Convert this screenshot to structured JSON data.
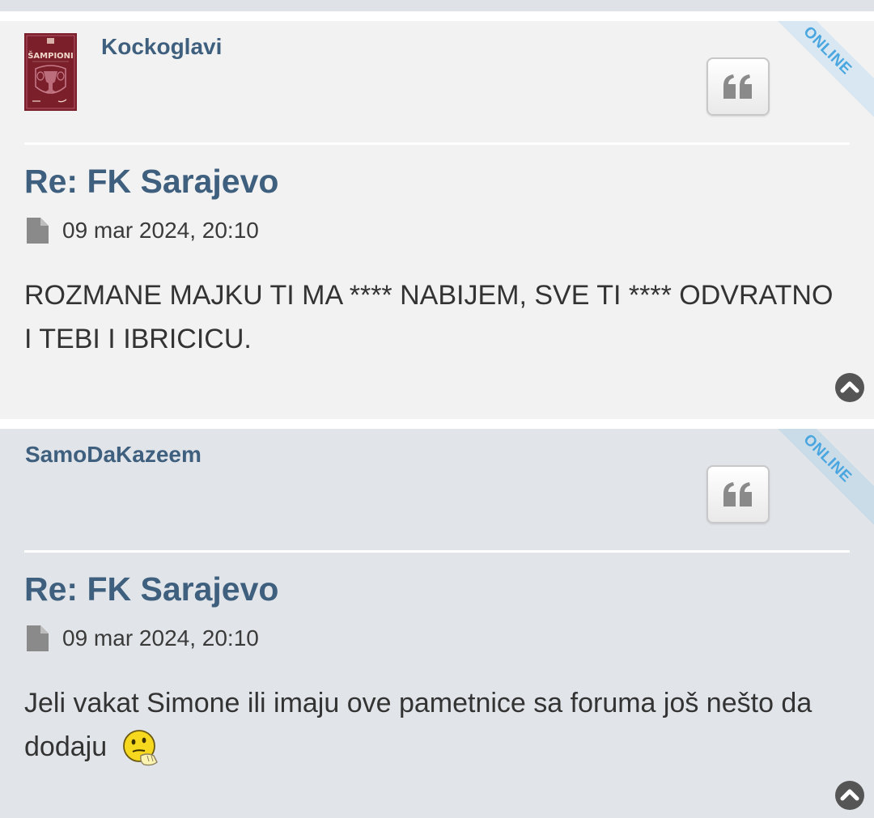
{
  "posts": [
    {
      "author": "Kockoglavi",
      "status": "ONLINE",
      "avatar": {
        "top_text": "ŠAMPIONI",
        "colors": {
          "bg": "#7b1f2b",
          "border": "#b3576a",
          "text": "#f0d7c8"
        }
      },
      "title": "Re: FK Sarajevo",
      "timestamp": "09 mar 2024, 20:10",
      "body": "ROZMANE MAJKU TI MA **** NABIJEM, SVE TI **** ODVRATNO I TEBI I IBRICICU."
    },
    {
      "author": "SamoDaKazeem",
      "status": "ONLINE",
      "title": "Re: FK Sarajevo",
      "timestamp": "09 mar 2024, 20:10",
      "body": "Jeli vakat Simone ili imaju ove pametnice sa foruma još nešto da dodaju",
      "emoji": "thinking-smiley"
    }
  ],
  "icons": {
    "quote": "quote-icon",
    "file": "file-icon",
    "back_to_top": "chevron-up-circle-icon"
  },
  "colors": {
    "accent": "#3e5f7e",
    "post_bg_1": "#f2f2f2",
    "post_bg_2": "#e1e4e8",
    "online": "#4aa6df"
  }
}
